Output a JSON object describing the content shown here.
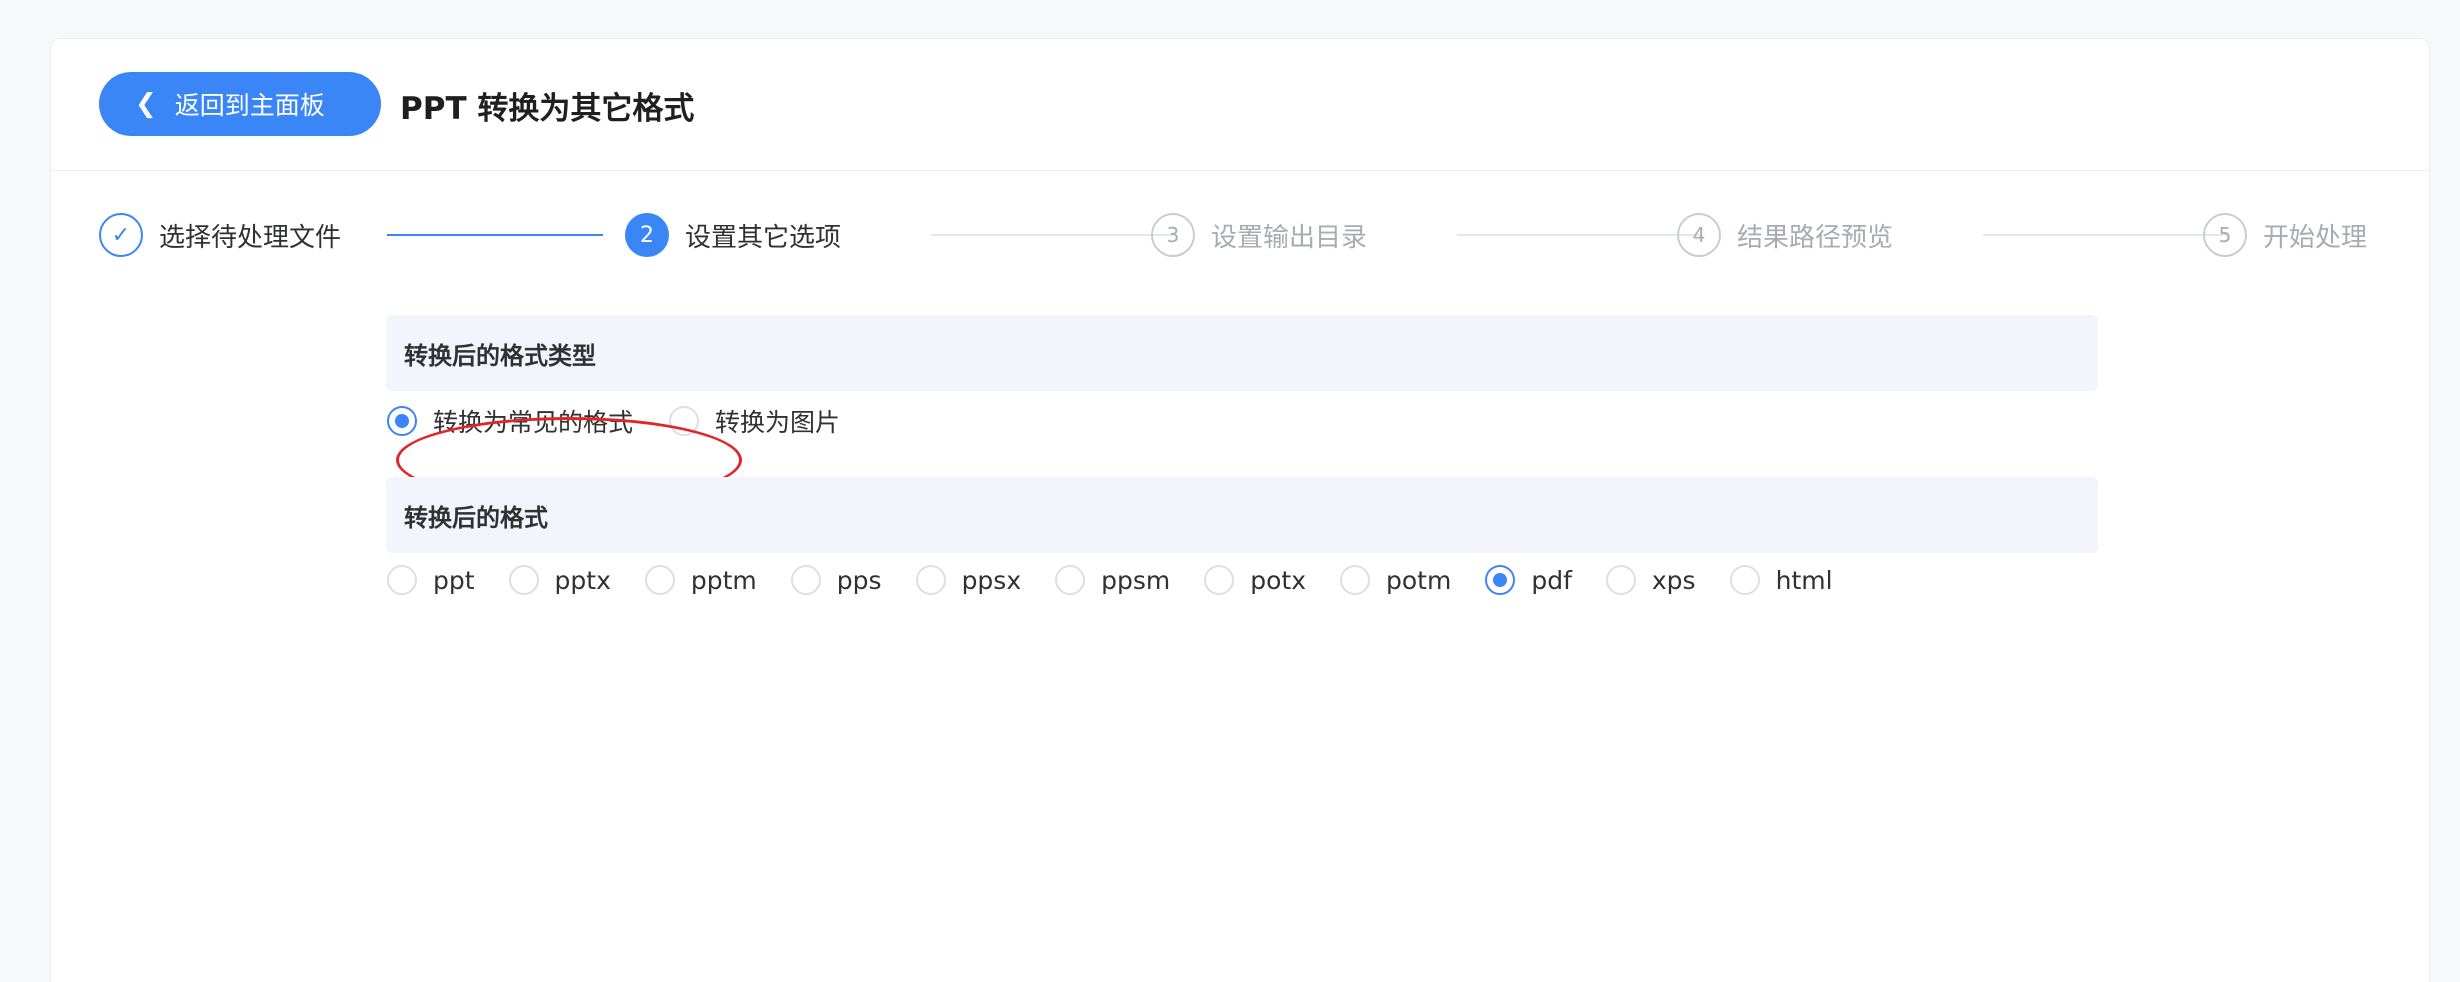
{
  "header": {
    "back_label": "返回到主面板",
    "title": "PPT 转换为其它格式"
  },
  "steps": [
    {
      "index": "",
      "label": "选择待处理文件",
      "state": "done",
      "icon": "check-icon"
    },
    {
      "index": "2",
      "label": "设置其它选项",
      "state": "active"
    },
    {
      "index": "3",
      "label": "设置输出目录",
      "state": "wait"
    },
    {
      "index": "4",
      "label": "结果路径预览",
      "state": "wait"
    },
    {
      "index": "5",
      "label": "开始处理",
      "state": "wait"
    }
  ],
  "format_type": {
    "heading": "转换后的格式类型",
    "options": [
      {
        "label": "转换为常见的格式",
        "checked": true
      },
      {
        "label": "转换为图片",
        "checked": false
      }
    ]
  },
  "format": {
    "heading": "转换后的格式",
    "options": [
      {
        "label": "ppt",
        "checked": false
      },
      {
        "label": "pptx",
        "checked": false
      },
      {
        "label": "pptm",
        "checked": false
      },
      {
        "label": "pps",
        "checked": false
      },
      {
        "label": "ppsx",
        "checked": false
      },
      {
        "label": "ppsm",
        "checked": false
      },
      {
        "label": "potx",
        "checked": false
      },
      {
        "label": "potm",
        "checked": false
      },
      {
        "label": "pdf",
        "checked": true
      },
      {
        "label": "xps",
        "checked": false
      },
      {
        "label": "html",
        "checked": false
      }
    ]
  },
  "colors": {
    "accent": "#3a86f7",
    "annotation": "#e0262a"
  }
}
